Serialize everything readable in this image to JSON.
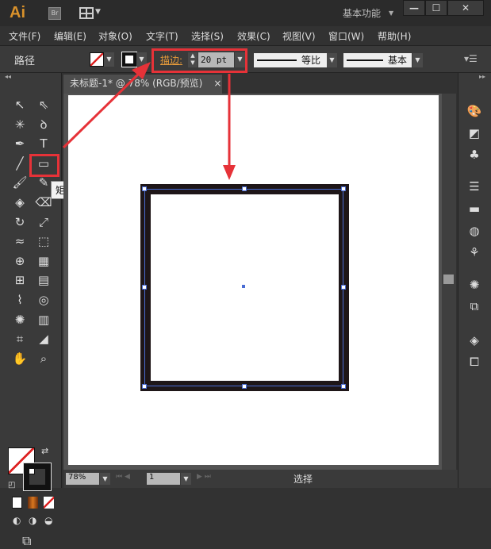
{
  "app": {
    "logo": "Ai",
    "bridge": "Br",
    "workspace": "基本功能",
    "minimize": "—",
    "maximize": "☐",
    "close": "✕"
  },
  "menu": [
    "文件(F)",
    "编辑(E)",
    "对象(O)",
    "文字(T)",
    "选择(S)",
    "效果(C)",
    "视图(V)",
    "窗口(W)",
    "帮助(H)"
  ],
  "control": {
    "selection_label": "路径",
    "stroke_label": "描边:",
    "stroke_value": "20 pt",
    "profile": "等比",
    "brush": "基本"
  },
  "document": {
    "tab_title": "未标题-1* @ 78% (RGB/预览)",
    "tab_close": "×"
  },
  "tooltip": "矩形工具 (M)",
  "status": {
    "zoom": "78%",
    "artboard": "1",
    "tool_status": "选择"
  },
  "colors": {
    "accent_highlight": "#e63238",
    "stroke": "#1e1618",
    "selection": "#4a6cd4"
  },
  "tools": [
    [
      "selection-icon",
      "↖"
    ],
    [
      "direct-selection-icon",
      "⇖"
    ],
    [
      "magic-wand-icon",
      "✳"
    ],
    [
      "lasso-icon",
      "ꝺ"
    ],
    [
      "pen-icon",
      "✒"
    ],
    [
      "type-icon",
      "T"
    ],
    [
      "line-icon",
      "╱"
    ],
    [
      "rectangle-icon",
      "▭"
    ],
    [
      "paintbrush-icon",
      "🖌"
    ],
    [
      "pencil-icon",
      "✎"
    ],
    [
      "blob-brush-icon",
      "◈"
    ],
    [
      "eraser-icon",
      "⌫"
    ],
    [
      "rotate-icon",
      "↻"
    ],
    [
      "scale-icon",
      "⤢"
    ],
    [
      "warp-icon",
      "≈"
    ],
    [
      "free-transform-icon",
      "⬚"
    ],
    [
      "shape-builder-icon",
      "⊕"
    ],
    [
      "perspective-icon",
      "▦"
    ],
    [
      "mesh-icon",
      "⊞"
    ],
    [
      "gradient-icon",
      "▤"
    ],
    [
      "eyedropper-icon",
      "⌇"
    ],
    [
      "blend-icon",
      "◎"
    ],
    [
      "symbol-sprayer-icon",
      "✺"
    ],
    [
      "graph-icon",
      "▥"
    ],
    [
      "artboard-icon",
      "⌗"
    ],
    [
      "slice-icon",
      "◢"
    ],
    [
      "hand-icon",
      "✋"
    ],
    [
      "zoom-icon",
      "⌕"
    ]
  ],
  "right_panel_icons": [
    "color-guide-icon",
    "swatches-icon",
    "symbols-icon",
    "stroke-panel-icon",
    "gradient-panel-icon",
    "transparency-icon",
    "brushes-icon",
    "appearance-icon",
    "graphic-styles-icon",
    "layers-icon",
    "artboards-icon"
  ]
}
